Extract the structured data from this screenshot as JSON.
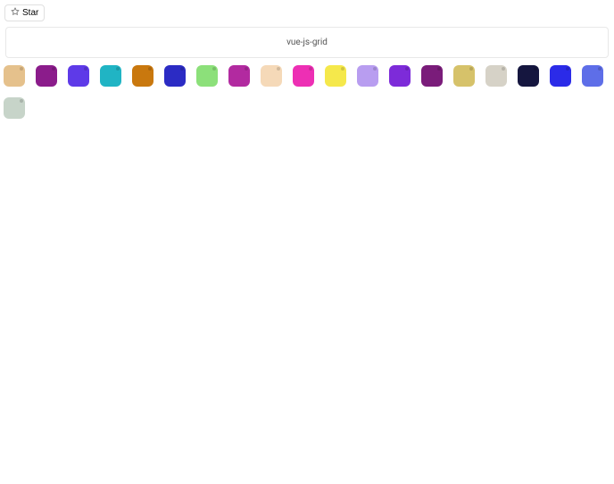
{
  "star_label": "Star",
  "header_title": "vue-js-grid",
  "tiles": [
    {
      "color": "#e5c18c"
    },
    {
      "color": "#8b1c8b"
    },
    {
      "color": "#5e3ae8"
    },
    {
      "color": "#20b4c4"
    },
    {
      "color": "#c9780e"
    },
    {
      "color": "#2b2bc4"
    },
    {
      "color": "#8ce07a"
    },
    {
      "color": "#b22aa0"
    },
    {
      "color": "#f5d9b8"
    },
    {
      "color": "#ed2fb4"
    },
    {
      "color": "#f5e84b"
    },
    {
      "color": "#b89df0"
    },
    {
      "color": "#7d2bd9"
    },
    {
      "color": "#7a1c7a"
    },
    {
      "color": "#d6c26a"
    },
    {
      "color": "#d6d2c7"
    },
    {
      "color": "#15163f"
    },
    {
      "color": "#2b2be8"
    },
    {
      "color": "#5e6ee8"
    },
    {
      "color": "#c7d4c9"
    }
  ]
}
